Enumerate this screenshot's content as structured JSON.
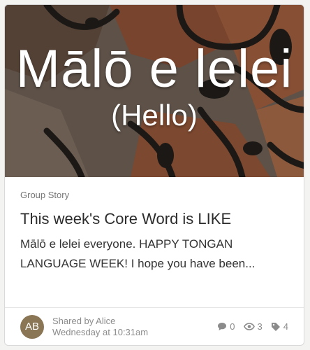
{
  "hero": {
    "title": "Mālō e lelei",
    "subtitle": "(Hello)"
  },
  "post": {
    "category": "Group Story",
    "title": "This week's Core Word is LIKE",
    "excerpt": "Mālō e lelei everyone. HAPPY TONGAN LANGUAGE WEEK! I hope you have been..."
  },
  "author": {
    "initials": "AB",
    "shared_by": "Shared by Alice",
    "time": "Wednesday at 10:31am"
  },
  "stats": {
    "comments": "0",
    "views": "3",
    "likes": "4"
  },
  "colors": {
    "avatar": "#8a7554",
    "tapa_dark": "#1f1c19",
    "tapa_brown": "#8a4e34"
  },
  "icons": [
    "comment-icon",
    "eye-icon",
    "tag-icon"
  ]
}
